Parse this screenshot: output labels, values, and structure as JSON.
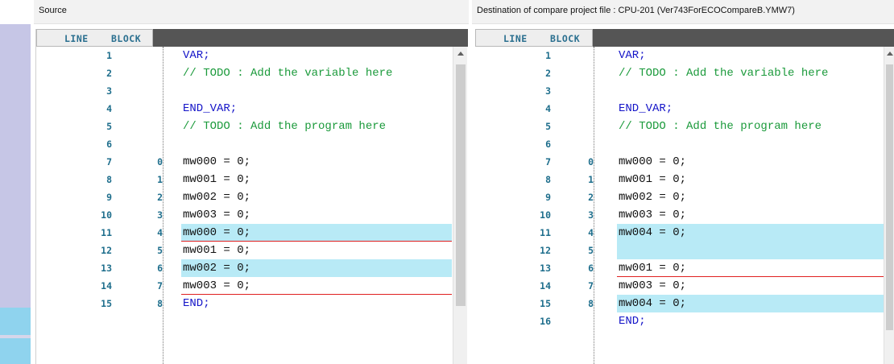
{
  "source_pane": {
    "title": "Source",
    "columns": {
      "line": "LINE",
      "block": "BLOCK"
    },
    "rows": [
      {
        "line": "1",
        "block": "",
        "code": "VAR;",
        "style": "kw",
        "highlight": false,
        "rule": false
      },
      {
        "line": "2",
        "block": "",
        "code": "// TODO : Add the variable here",
        "style": "cm",
        "highlight": false,
        "rule": false
      },
      {
        "line": "3",
        "block": "",
        "code": "",
        "style": "",
        "highlight": false,
        "rule": false
      },
      {
        "line": "4",
        "block": "",
        "code": "END_VAR;",
        "style": "kw",
        "highlight": false,
        "rule": false
      },
      {
        "line": "5",
        "block": "",
        "code": "// TODO : Add the program here",
        "style": "cm",
        "highlight": false,
        "rule": false
      },
      {
        "line": "6",
        "block": "",
        "code": "",
        "style": "",
        "highlight": false,
        "rule": false
      },
      {
        "line": "7",
        "block": "0",
        "code": "mw000 = 0;",
        "style": "",
        "highlight": false,
        "rule": false
      },
      {
        "line": "8",
        "block": "1",
        "code": "mw001 = 0;",
        "style": "",
        "highlight": false,
        "rule": false
      },
      {
        "line": "9",
        "block": "2",
        "code": "mw002 = 0;",
        "style": "",
        "highlight": false,
        "rule": false
      },
      {
        "line": "10",
        "block": "3",
        "code": "mw003 = 0;",
        "style": "",
        "highlight": false,
        "rule": false
      },
      {
        "line": "11",
        "block": "4",
        "code": "mw000 = 0;",
        "style": "",
        "highlight": true,
        "rule": true
      },
      {
        "line": "12",
        "block": "5",
        "code": "mw001 = 0;",
        "style": "",
        "highlight": false,
        "rule": false
      },
      {
        "line": "13",
        "block": "6",
        "code": "mw002 = 0;",
        "style": "",
        "highlight": true,
        "rule": false
      },
      {
        "line": "14",
        "block": "7",
        "code": "mw003 = 0;",
        "style": "",
        "highlight": false,
        "rule": true
      },
      {
        "line": "15",
        "block": "8",
        "code": "END;",
        "style": "kw",
        "highlight": false,
        "rule": false
      }
    ]
  },
  "destination_pane": {
    "title": "Destination of compare project file : CPU-201    (Ver743ForECOCompareB.YMW7)",
    "columns": {
      "line": "LINE",
      "block": "BLOCK"
    },
    "rows": [
      {
        "line": "1",
        "block": "",
        "code": "VAR;",
        "style": "kw",
        "highlight": false,
        "rule": false
      },
      {
        "line": "2",
        "block": "",
        "code": "// TODO : Add the variable here",
        "style": "cm",
        "highlight": false,
        "rule": false
      },
      {
        "line": "3",
        "block": "",
        "code": "",
        "style": "",
        "highlight": false,
        "rule": false
      },
      {
        "line": "4",
        "block": "",
        "code": "END_VAR;",
        "style": "kw",
        "highlight": false,
        "rule": false
      },
      {
        "line": "5",
        "block": "",
        "code": "// TODO : Add the program here",
        "style": "cm",
        "highlight": false,
        "rule": false
      },
      {
        "line": "6",
        "block": "",
        "code": "",
        "style": "",
        "highlight": false,
        "rule": false
      },
      {
        "line": "7",
        "block": "0",
        "code": "mw000 = 0;",
        "style": "",
        "highlight": false,
        "rule": false
      },
      {
        "line": "8",
        "block": "1",
        "code": "mw001 = 0;",
        "style": "",
        "highlight": false,
        "rule": false
      },
      {
        "line": "9",
        "block": "2",
        "code": "mw002 = 0;",
        "style": "",
        "highlight": false,
        "rule": false
      },
      {
        "line": "10",
        "block": "3",
        "code": "mw003 = 0;",
        "style": "",
        "highlight": false,
        "rule": false
      },
      {
        "line": "11",
        "block": "4",
        "code": "mw004 = 0;",
        "style": "",
        "highlight": true,
        "rule": false
      },
      {
        "line": "12",
        "block": "5",
        "code": "",
        "style": "",
        "highlight": true,
        "rule": false
      },
      {
        "line": "13",
        "block": "6",
        "code": "mw001 = 0;",
        "style": "",
        "highlight": false,
        "rule": true
      },
      {
        "line": "14",
        "block": "7",
        "code": "mw003 = 0;",
        "style": "",
        "highlight": false,
        "rule": false
      },
      {
        "line": "15",
        "block": "8",
        "code": "mw004 = 0;",
        "style": "",
        "highlight": true,
        "rule": false
      },
      {
        "line": "16",
        "block": "",
        "code": "END;",
        "style": "kw",
        "highlight": false,
        "rule": false
      }
    ]
  },
  "colors": {
    "diff_highlight": "#b8eaf6",
    "diff_rule": "#e02020",
    "keyword": "#1414c8",
    "comment": "#1b9a3b",
    "line_number": "#1e6e8c"
  },
  "overview_strip": {
    "icon": "diff-overview-bar"
  }
}
